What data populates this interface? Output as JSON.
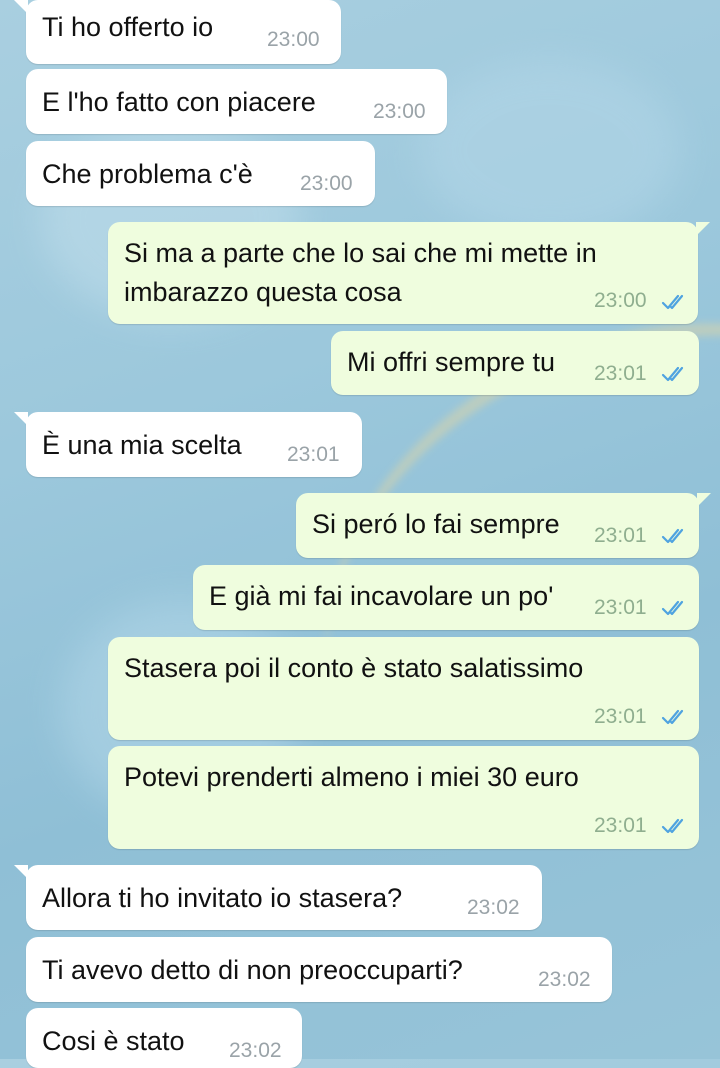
{
  "colors": {
    "incoming_bubble": "#ffffff",
    "outgoing_bubble": "#effdde",
    "read_ticks": "#4fa3e0"
  },
  "messages": [
    {
      "text": "Ti ho offerto io",
      "time": "23:00",
      "direction": "incoming"
    },
    {
      "text": "E l'ho fatto con piacere",
      "time": "23:00",
      "direction": "incoming"
    },
    {
      "text": "Che problema c'è",
      "time": "23:00",
      "direction": "incoming"
    },
    {
      "text": "Si ma a parte che lo sai che mi mette in",
      "text2": "imbarazzo questa cosa",
      "time": "23:00",
      "direction": "outgoing",
      "status": "read"
    },
    {
      "text": "Mi offri sempre tu",
      "time": "23:01",
      "direction": "outgoing",
      "status": "read"
    },
    {
      "text": "È una mia scelta",
      "time": "23:01",
      "direction": "incoming"
    },
    {
      "text": "Si peró lo fai sempre",
      "time": "23:01",
      "direction": "outgoing",
      "status": "read"
    },
    {
      "text": "E già mi fai incavolare un po'",
      "time": "23:01",
      "direction": "outgoing",
      "status": "read"
    },
    {
      "text": "Stasera poi il conto è stato salatissimo",
      "time": "23:01",
      "direction": "outgoing",
      "status": "read"
    },
    {
      "text": "Potevi prenderti almeno i miei 30 euro",
      "time": "23:01",
      "direction": "outgoing",
      "status": "read"
    },
    {
      "text": "Allora ti ho invitato io stasera?",
      "time": "23:02",
      "direction": "incoming"
    },
    {
      "text": "Ti avevo detto di non preoccuparti?",
      "time": "23:02",
      "direction": "incoming"
    },
    {
      "text": "Cosi è stato",
      "time": "23:02",
      "direction": "incoming"
    }
  ]
}
